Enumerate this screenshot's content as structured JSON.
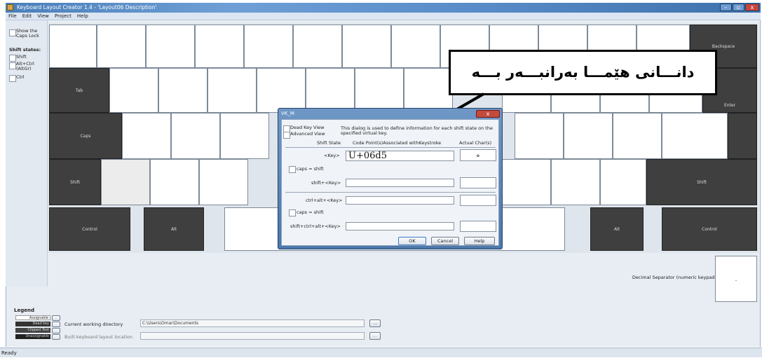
{
  "window": {
    "title": "Keyboard Layout Creator 1.4 - 'Layout06 Description'",
    "controls": [
      "–",
      "▫",
      "x"
    ]
  },
  "menu": [
    "File",
    "Edit",
    "View",
    "Project",
    "Help"
  ],
  "left_panel": {
    "show_caps_lock": "Show the Caps Lock",
    "shift_states_heading": "Shift states:",
    "shift": "Shift",
    "altgr": "Alt+Ctrl (AltGr)",
    "ctrl": "Ctrl"
  },
  "keys": {
    "backspace": "Backspace",
    "tab": "Tab",
    "enter": "Enter",
    "caps": "Caps",
    "shift_left": "Shift",
    "shift_right": "Shift",
    "control_left": "Control",
    "alt_left": "Alt",
    "alt_right": "Alt",
    "control_right": "Control",
    "decimal_separator": "Decimal Separator (numeric keypad)",
    "decimal_value": "."
  },
  "annotation": {
    "text": "دانـــانى هێمـــا بەرانبـــەر بـــە"
  },
  "dialog": {
    "title": "VK_M",
    "dead_key_view": "Dead Key View",
    "advanced_view": "Advanced View",
    "description": "This dialog is used to define information for each shift state on the specified virtual key.",
    "col_shift_state": "Shift State",
    "col_code_points": "Code Point(s)Associated withKeystroke",
    "col_actual": "Actual Char(s)",
    "key_label": "<Key>",
    "key_value": "U+06d5",
    "key_actual": "ە",
    "caps_eq_shift_1": "caps = shift",
    "shift_key_label": "shift+<Key>",
    "ctrl_alt_key_label": "ctrl+alt+<Key>",
    "caps_eq_shift_2": "caps = shift",
    "shift_ctrl_alt_key_label": "shift+ctrl+alt+<Key>",
    "ok": "OK",
    "cancel": "Cancel",
    "help": "Help"
  },
  "legend": {
    "heading": "Legend",
    "items": [
      "Assignable",
      "Dead key",
      "Clipped Text",
      "Unassignable"
    ]
  },
  "bottom": {
    "cwd_label": "Current working directory",
    "cwd_value": "C:\\Users\\Omar\\Documents",
    "build_label": "Built keyboard layout location",
    "build_value": "",
    "browse": "..."
  },
  "status": "Ready",
  "colors": {
    "title_bar": "#5a8dc9",
    "dark_key": "#3f3f3f",
    "dialog_frame": "#5a82b5"
  }
}
